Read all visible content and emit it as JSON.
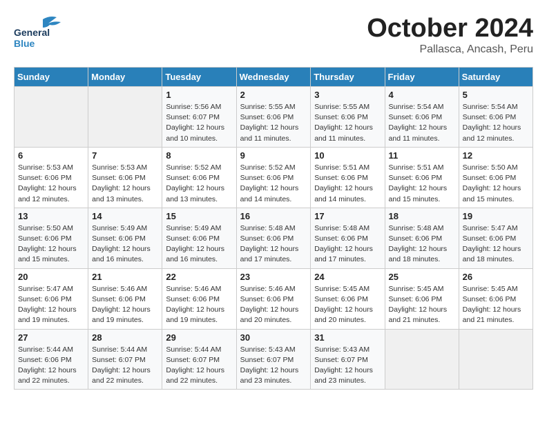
{
  "logo": {
    "line1": "General",
    "line2": "Blue"
  },
  "title": "October 2024",
  "location": "Pallasca, Ancash, Peru",
  "days_header": [
    "Sunday",
    "Monday",
    "Tuesday",
    "Wednesday",
    "Thursday",
    "Friday",
    "Saturday"
  ],
  "weeks": [
    [
      {
        "num": "",
        "info": ""
      },
      {
        "num": "",
        "info": ""
      },
      {
        "num": "1",
        "info": "Sunrise: 5:56 AM\nSunset: 6:07 PM\nDaylight: 12 hours and 10 minutes."
      },
      {
        "num": "2",
        "info": "Sunrise: 5:55 AM\nSunset: 6:06 PM\nDaylight: 12 hours and 11 minutes."
      },
      {
        "num": "3",
        "info": "Sunrise: 5:55 AM\nSunset: 6:06 PM\nDaylight: 12 hours and 11 minutes."
      },
      {
        "num": "4",
        "info": "Sunrise: 5:54 AM\nSunset: 6:06 PM\nDaylight: 12 hours and 11 minutes."
      },
      {
        "num": "5",
        "info": "Sunrise: 5:54 AM\nSunset: 6:06 PM\nDaylight: 12 hours and 12 minutes."
      }
    ],
    [
      {
        "num": "6",
        "info": "Sunrise: 5:53 AM\nSunset: 6:06 PM\nDaylight: 12 hours and 12 minutes."
      },
      {
        "num": "7",
        "info": "Sunrise: 5:53 AM\nSunset: 6:06 PM\nDaylight: 12 hours and 13 minutes."
      },
      {
        "num": "8",
        "info": "Sunrise: 5:52 AM\nSunset: 6:06 PM\nDaylight: 12 hours and 13 minutes."
      },
      {
        "num": "9",
        "info": "Sunrise: 5:52 AM\nSunset: 6:06 PM\nDaylight: 12 hours and 14 minutes."
      },
      {
        "num": "10",
        "info": "Sunrise: 5:51 AM\nSunset: 6:06 PM\nDaylight: 12 hours and 14 minutes."
      },
      {
        "num": "11",
        "info": "Sunrise: 5:51 AM\nSunset: 6:06 PM\nDaylight: 12 hours and 15 minutes."
      },
      {
        "num": "12",
        "info": "Sunrise: 5:50 AM\nSunset: 6:06 PM\nDaylight: 12 hours and 15 minutes."
      }
    ],
    [
      {
        "num": "13",
        "info": "Sunrise: 5:50 AM\nSunset: 6:06 PM\nDaylight: 12 hours and 15 minutes."
      },
      {
        "num": "14",
        "info": "Sunrise: 5:49 AM\nSunset: 6:06 PM\nDaylight: 12 hours and 16 minutes."
      },
      {
        "num": "15",
        "info": "Sunrise: 5:49 AM\nSunset: 6:06 PM\nDaylight: 12 hours and 16 minutes."
      },
      {
        "num": "16",
        "info": "Sunrise: 5:48 AM\nSunset: 6:06 PM\nDaylight: 12 hours and 17 minutes."
      },
      {
        "num": "17",
        "info": "Sunrise: 5:48 AM\nSunset: 6:06 PM\nDaylight: 12 hours and 17 minutes."
      },
      {
        "num": "18",
        "info": "Sunrise: 5:48 AM\nSunset: 6:06 PM\nDaylight: 12 hours and 18 minutes."
      },
      {
        "num": "19",
        "info": "Sunrise: 5:47 AM\nSunset: 6:06 PM\nDaylight: 12 hours and 18 minutes."
      }
    ],
    [
      {
        "num": "20",
        "info": "Sunrise: 5:47 AM\nSunset: 6:06 PM\nDaylight: 12 hours and 19 minutes."
      },
      {
        "num": "21",
        "info": "Sunrise: 5:46 AM\nSunset: 6:06 PM\nDaylight: 12 hours and 19 minutes."
      },
      {
        "num": "22",
        "info": "Sunrise: 5:46 AM\nSunset: 6:06 PM\nDaylight: 12 hours and 19 minutes."
      },
      {
        "num": "23",
        "info": "Sunrise: 5:46 AM\nSunset: 6:06 PM\nDaylight: 12 hours and 20 minutes."
      },
      {
        "num": "24",
        "info": "Sunrise: 5:45 AM\nSunset: 6:06 PM\nDaylight: 12 hours and 20 minutes."
      },
      {
        "num": "25",
        "info": "Sunrise: 5:45 AM\nSunset: 6:06 PM\nDaylight: 12 hours and 21 minutes."
      },
      {
        "num": "26",
        "info": "Sunrise: 5:45 AM\nSunset: 6:06 PM\nDaylight: 12 hours and 21 minutes."
      }
    ],
    [
      {
        "num": "27",
        "info": "Sunrise: 5:44 AM\nSunset: 6:06 PM\nDaylight: 12 hours and 22 minutes."
      },
      {
        "num": "28",
        "info": "Sunrise: 5:44 AM\nSunset: 6:07 PM\nDaylight: 12 hours and 22 minutes."
      },
      {
        "num": "29",
        "info": "Sunrise: 5:44 AM\nSunset: 6:07 PM\nDaylight: 12 hours and 22 minutes."
      },
      {
        "num": "30",
        "info": "Sunrise: 5:43 AM\nSunset: 6:07 PM\nDaylight: 12 hours and 23 minutes."
      },
      {
        "num": "31",
        "info": "Sunrise: 5:43 AM\nSunset: 6:07 PM\nDaylight: 12 hours and 23 minutes."
      },
      {
        "num": "",
        "info": ""
      },
      {
        "num": "",
        "info": ""
      }
    ]
  ]
}
